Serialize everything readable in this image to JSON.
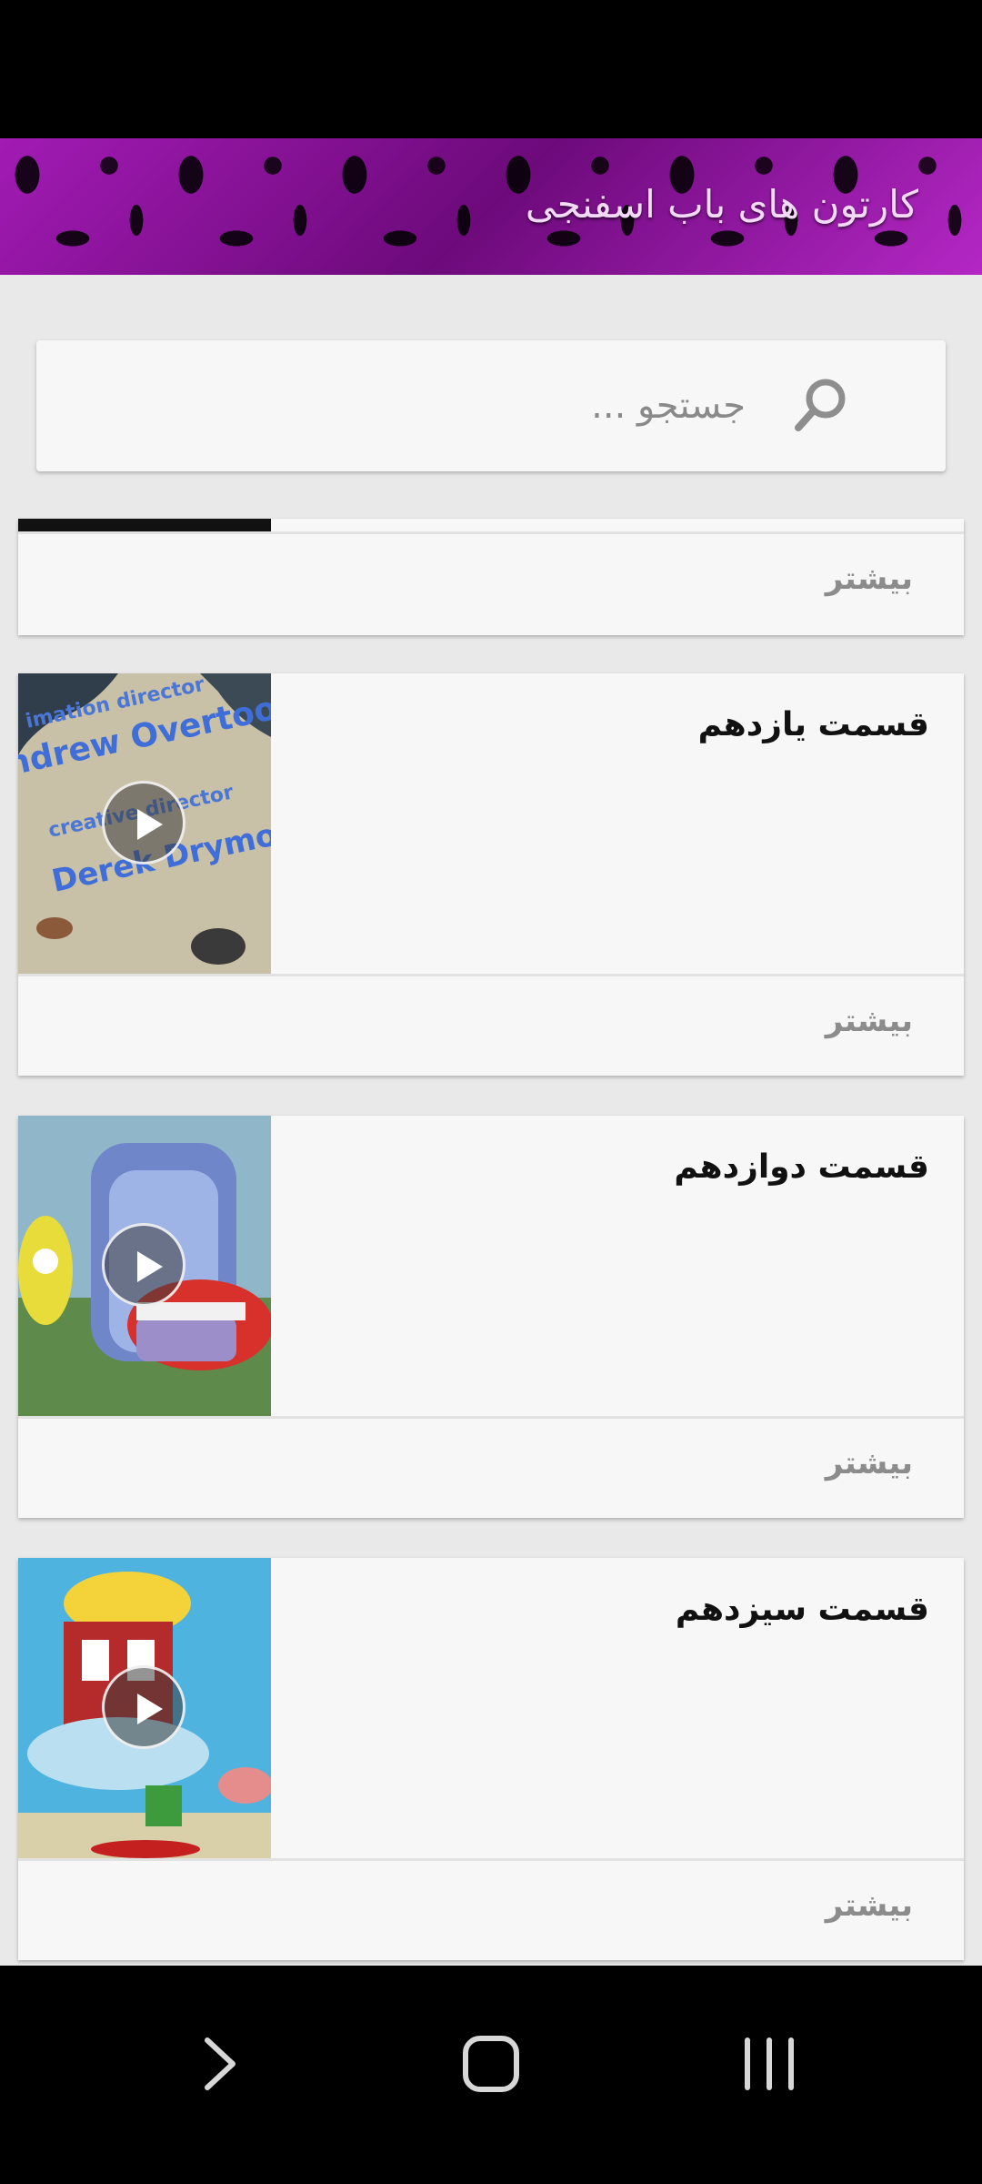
{
  "header": {
    "title": "کارتون های باب اسفنجی"
  },
  "search": {
    "placeholder": "جستجو ..."
  },
  "more_label": "بیشتر",
  "items": [
    {
      "title": "",
      "more": "بیشتر"
    },
    {
      "title": "قسمت یازدهم",
      "more": "بیشتر",
      "thumb_text": [
        "imation director",
        "ndrew Overtoom",
        "creative director",
        "Derek Drymon"
      ]
    },
    {
      "title": "قسمت دوازدهم",
      "more": "بیشتر"
    },
    {
      "title": "قسمت سیزدهم",
      "more": "بیشتر"
    }
  ],
  "colors": {
    "header_accent": "#8a0d9a",
    "title_text": "#f2d9f6",
    "background": "#e9e9e9",
    "card": "#f7f7f7"
  },
  "nav": {
    "icons": [
      "back-chevron-icon",
      "home-icon",
      "recents-icon"
    ]
  }
}
